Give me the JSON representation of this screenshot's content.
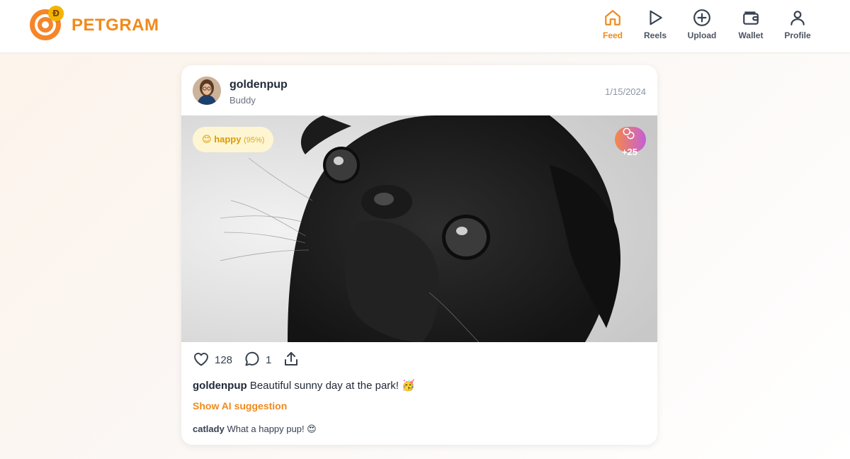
{
  "app": {
    "name": "PETGRAM",
    "coin_symbol": "Đ",
    "accent_color": "#f08a1c"
  },
  "nav": {
    "items": [
      {
        "label": "Feed",
        "icon": "home-icon",
        "active": true
      },
      {
        "label": "Reels",
        "icon": "play-icon",
        "active": false
      },
      {
        "label": "Upload",
        "icon": "plus-circle-icon",
        "active": false
      },
      {
        "label": "Wallet",
        "icon": "wallet-icon",
        "active": false
      },
      {
        "label": "Profile",
        "icon": "user-icon",
        "active": false
      }
    ]
  },
  "post": {
    "username": "goldenpup",
    "pet_name": "Buddy",
    "date": "1/15/2024",
    "mood": {
      "emoji": "😊",
      "label": "happy",
      "confidence": "(95%)"
    },
    "reward": "+25",
    "likes": "128",
    "comments_count": "1",
    "caption_user": "goldenpup",
    "caption_text": "Beautiful sunny day at the park! 🥳",
    "ai_suggestion_label": "Show AI suggestion",
    "comments": [
      {
        "user": "catlady",
        "text": "What a happy pup! 😍"
      }
    ]
  }
}
